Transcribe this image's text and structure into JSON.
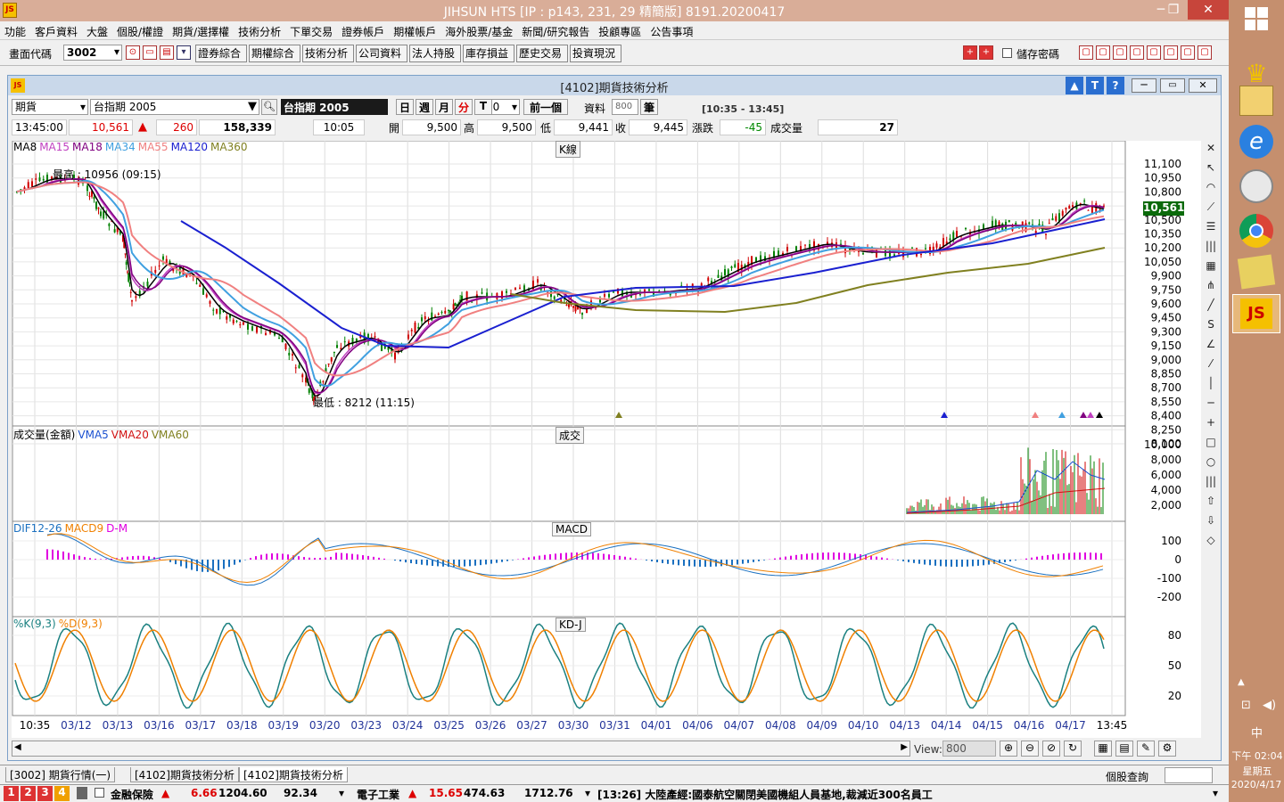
{
  "app": {
    "title": "JIHSUN HTS     [IP : p143, 231, 29 精簡版] 8191.20200417",
    "logo": "jihsun-logo"
  },
  "menu": [
    "功能",
    "客戶資料",
    "大盤",
    "個股/權證",
    "期貨/選擇權",
    "技術分析",
    "下單交易",
    "證券帳戶",
    "期權帳戶",
    "海外股票/基金",
    "新聞/研究報告",
    "投顧專區",
    "公告事項"
  ],
  "toolbar": {
    "code_label": "畫面代碼",
    "code_value": "3002",
    "buttons": [
      "證券綜合",
      "期權綜合",
      "技術分析",
      "公司資料",
      "法人持股",
      "庫存損益",
      "歷史交易",
      "投資現況"
    ],
    "save_pwd": "儲存密碼"
  },
  "window": {
    "title": "[4102]期貨技術分析",
    "type_select": "期貨",
    "symbol": "台指期 2005",
    "symbol_label": "台指期 2005",
    "periods": [
      "日",
      "週",
      "月",
      "分",
      "T"
    ],
    "interval": "10",
    "prev_btn": "前一個",
    "data_label": "資料",
    "data_count": "800",
    "unit": "筆",
    "range": "[10:35 - 13:45]",
    "quote": {
      "time": "13:45:00",
      "price": "10,561",
      "change": "260",
      "volume_total": "158,339",
      "bar_time": "10:05",
      "open_l": "開",
      "open": "9,500",
      "high_l": "高",
      "high": "9,500",
      "low_l": "低",
      "low": "9,441",
      "close_l": "收",
      "close": "9,445",
      "chg_l": "漲跌",
      "chg": "-45",
      "vol_l": "成交量",
      "vol": "27"
    }
  },
  "kline": {
    "box": "K線",
    "ma": [
      {
        "name": "MA8",
        "color": "#000000"
      },
      {
        "name": "MA15",
        "color": "#c040c0"
      },
      {
        "name": "MA18",
        "color": "#800080"
      },
      {
        "name": "MA34",
        "color": "#40a0e0"
      },
      {
        "name": "MA55",
        "color": "#f08080"
      },
      {
        "name": "MA120",
        "color": "#1a20d0"
      },
      {
        "name": "MA360",
        "color": "#808020"
      }
    ],
    "high_note": "最高 : 10956 (09:15)",
    "low_note": "最低 : 8212 (11:15)",
    "last_price": "10,561",
    "yticks": [
      "11,100",
      "10,950",
      "10,800",
      "10,650",
      "10,500",
      "10,350",
      "10,200",
      "10,050",
      "9,900",
      "9,750",
      "9,600",
      "9,450",
      "9,300",
      "9,150",
      "9,000",
      "8,850",
      "8,700",
      "8,550",
      "8,400",
      "8,250",
      "8,100"
    ]
  },
  "volume": {
    "box": "成交",
    "label": "成交量(金額)",
    "vma": [
      {
        "name": "VMA5",
        "color": "#1a50d0"
      },
      {
        "name": "VMA20",
        "color": "#d01010"
      },
      {
        "name": "VMA60",
        "color": "#808020"
      }
    ],
    "yticks": [
      "10,000",
      "8,000",
      "6,000",
      "4,000",
      "2,000"
    ]
  },
  "macd": {
    "box": "MACD",
    "legend": [
      {
        "name": "DIF12-26",
        "color": "#1a70c0"
      },
      {
        "name": "MACD9",
        "color": "#f08000"
      },
      {
        "name": "D-M",
        "color": "#e000e0"
      }
    ],
    "yticks": [
      "100",
      "0",
      "-100",
      "-200"
    ]
  },
  "kd": {
    "box": "KD-J",
    "legend": [
      {
        "name": "%K(9,3)",
        "color": "#1a8080"
      },
      {
        "name": "%D(9,3)",
        "color": "#f08000"
      }
    ],
    "yticks": [
      "80",
      "50",
      "20"
    ]
  },
  "xaxis": [
    "10:35",
    "03/12",
    "03/13",
    "03/16",
    "03/17",
    "03/18",
    "03/19",
    "03/20",
    "03/23",
    "03/24",
    "03/25",
    "03/26",
    "03/27",
    "03/30",
    "03/31",
    "04/01",
    "04/06",
    "04/07",
    "04/08",
    "04/09",
    "04/10",
    "04/13",
    "04/14",
    "04/15",
    "04/16",
    "04/17",
    "13:45"
  ],
  "view": {
    "label": "View:",
    "value": "800"
  },
  "tabs": [
    "[3002] 期貨行情(一)",
    "[4102]期貨技術分析",
    "[4102]期貨技術分析"
  ],
  "stock_query": "個股查詢",
  "status": {
    "nums": [
      "1",
      "2",
      "3",
      "4"
    ],
    "item1": "金融保險",
    "v1": "6.66",
    "v1b": "1204.60",
    "v1c": "92.34",
    "item2": "電子工業",
    "v2": "15.65",
    "v2b": "474.63",
    "v2c": "1712.76",
    "news": "[13:26] 大陸產經:國泰航空關閉美國機組人員基地,裁減近300名員工"
  },
  "clock": {
    "time": "下午 02:04",
    "day": "星期五",
    "date": "2020/4/17",
    "ime": "中"
  }
}
